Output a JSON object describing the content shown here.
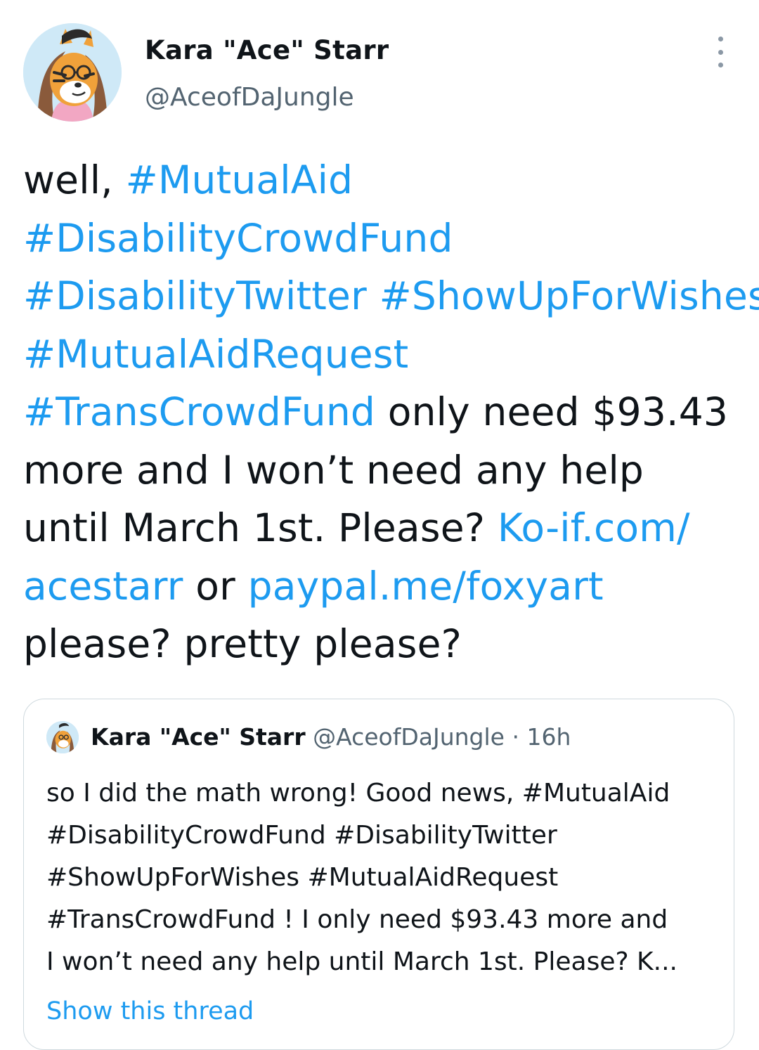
{
  "author": {
    "name": "Kara \"Ace\" Starr",
    "handle": "@AceofDaJungle",
    "avatar_icon": "tiger-avatar-icon"
  },
  "tweet": {
    "lines": [
      [
        {
          "t": "well, "
        },
        {
          "t": "#MutualAid",
          "k": "tag"
        }
      ],
      [
        {
          "t": "#DisabilityCrowdFund",
          "k": "tag"
        }
      ],
      [
        {
          "t": "#DisabilityTwitter",
          "k": "tag"
        },
        {
          "t": " "
        },
        {
          "t": "#ShowUpForWishes",
          "k": "tag"
        }
      ],
      [
        {
          "t": "#MutualAidRequest",
          "k": "tag"
        }
      ],
      [
        {
          "t": "#TransCrowdFund",
          "k": "tag"
        },
        {
          "t": " only need $93.43"
        }
      ],
      [
        {
          "t": "more and I won’t need any help"
        }
      ],
      [
        {
          "t": "until March 1st. Please? "
        },
        {
          "t": "Ko-if.com/",
          "k": "link"
        }
      ],
      [
        {
          "t": "acestarr",
          "k": "link"
        },
        {
          "t": " or "
        },
        {
          "t": "paypal.me/foxyart",
          "k": "link"
        }
      ],
      [
        {
          "t": "please? pretty please?"
        }
      ]
    ]
  },
  "quoted": {
    "name": "Kara \"Ace\" Starr",
    "handle": "@AceofDaJungle",
    "separator": "·",
    "time": "16h",
    "lines": [
      "so I did the math wrong! Good news, #MutualAid",
      "#DisabilityCrowdFund #DisabilityTwitter",
      "#ShowUpForWishes #MutualAidRequest",
      "#TransCrowdFund ! I only need $93.43 more and",
      "I won’t need any help until March 1st. Please? K..."
    ],
    "show_thread": "Show this thread"
  },
  "colors": {
    "link": "#1d9bf0",
    "secondary_text": "#536471",
    "border": "#cfd9de"
  }
}
